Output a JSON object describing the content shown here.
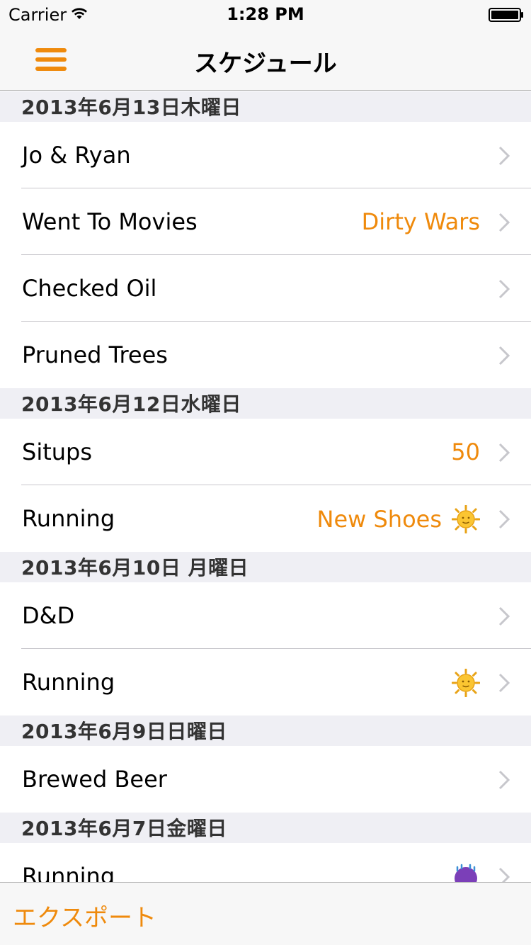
{
  "status_bar": {
    "carrier": "Carrier",
    "time": "1:28 PM"
  },
  "nav": {
    "title": "スケジュール",
    "menu_icon": "hamburger-menu-icon"
  },
  "colors": {
    "accent": "#ef8a0c",
    "section_bg": "#efeff4",
    "separator": "#c8c7cc"
  },
  "sections": [
    {
      "header": "2013年6月13日木曜日",
      "rows": [
        {
          "title": "Jo & Ryan",
          "detail": ""
        },
        {
          "title": "Went To Movies",
          "detail": "Dirty Wars"
        },
        {
          "title": "Checked Oil",
          "detail": ""
        },
        {
          "title": "Pruned Trees",
          "detail": ""
        }
      ]
    },
    {
      "header": "2013年6月12日水曜日",
      "rows": [
        {
          "title": "Situps",
          "detail": "50"
        },
        {
          "title": "Running",
          "detail": "New Shoes",
          "icon": "sun-icon"
        }
      ]
    },
    {
      "header": "2013年6月10日 月曜日",
      "rows": [
        {
          "title": "D&D",
          "detail": ""
        },
        {
          "title": "Running",
          "detail": "",
          "icon": "sun-icon"
        }
      ]
    },
    {
      "header": "2013年6月9日日曜日",
      "rows": [
        {
          "title": "Brewed Beer",
          "detail": ""
        }
      ]
    },
    {
      "header": "2013年6月7日金曜日",
      "rows": [
        {
          "title": "Running",
          "detail": "",
          "icon": "rain-cloud-icon"
        }
      ]
    }
  ],
  "toolbar": {
    "export_label": "エクスポート"
  }
}
